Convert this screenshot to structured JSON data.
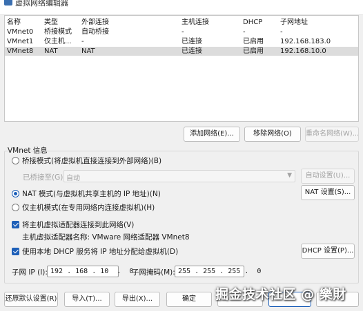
{
  "window": {
    "title": "虚拟网络编辑器"
  },
  "table": {
    "columns": [
      "名称",
      "类型",
      "外部连接",
      "主机连接",
      "DHCP",
      "子网地址"
    ],
    "rows": [
      [
        "VMnet0",
        "桥接模式",
        "自动桥接",
        "-",
        "-",
        "-"
      ],
      [
        "VMnet1",
        "仅主机...",
        "-",
        "已连接",
        "已启用",
        "192.168.183.0"
      ],
      [
        "VMnet8",
        "NAT",
        "NAT",
        "已连接",
        "已启用",
        "192.168.10.0"
      ]
    ],
    "selected_row": "VMnet8"
  },
  "table_buttons": {
    "add": "添加网络(E)...",
    "remove": "移除网络(O)",
    "rename": "重命名网络(W)..."
  },
  "vmnet_info": {
    "title": "VMnet 信息",
    "bridged_label": "桥接模式(将虚拟机直接连接到外部网络)(B)",
    "bridged_to_label": "已桥接至(G):",
    "bridged_to_value": "自动",
    "auto_settings": "自动设置(U)...",
    "nat_label": "NAT 模式(与虚拟机共享主机的 IP 地址)(N)",
    "nat_settings": "NAT 设置(S)...",
    "hostonly_label": "仅主机模式(在专用网络内连接虚拟机)(H)",
    "connect_adapter_label": "将主机虚拟适配器连接到此网络(V)",
    "adapter_name_label": "主机虚拟适配器名称: VMware 网络适配器 VMnet8",
    "dhcp_label": "使用本地 DHCP 服务将 IP 地址分配给虚拟机(D)",
    "dhcp_settings": "DHCP 设置(P)...",
    "subnet_ip_label": "子网 IP (I):",
    "subnet_ip_value": "192 . 168 . 10  .  0",
    "subnet_mask_label": "子网掩码(M):",
    "subnet_mask_value": "255 . 255 . 255 .  0",
    "selected_mode": "nat"
  },
  "footer": {
    "restore": "还原默认设置(R)",
    "import": "导入(T)...",
    "export": "导出(X)...",
    "ok": "确定"
  },
  "watermark": "掘金技术社区 @ 樂財"
}
